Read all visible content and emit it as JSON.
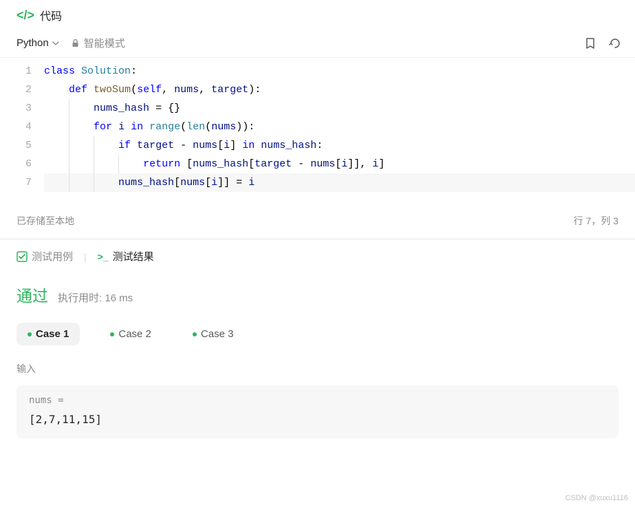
{
  "header": {
    "title": "代码"
  },
  "toolbar": {
    "language": "Python",
    "mode": "智能模式"
  },
  "code": {
    "lines": [
      "1",
      "2",
      "3",
      "4",
      "5",
      "6",
      "7"
    ]
  },
  "status": {
    "save_text": "已存储至本地",
    "position": "行 7，列 3"
  },
  "result_tabs": {
    "test_cases": "测试用例",
    "test_results": "测试结果"
  },
  "verdict": {
    "status": "通过",
    "runtime": "执行用时: 16 ms"
  },
  "cases": {
    "case1": "Case 1",
    "case2": "Case 2",
    "case3": "Case 3"
  },
  "input": {
    "label": "输入",
    "var_name": "nums =",
    "var_value": "[2,7,11,15]"
  },
  "watermark": "CSDN @xuxu1116"
}
